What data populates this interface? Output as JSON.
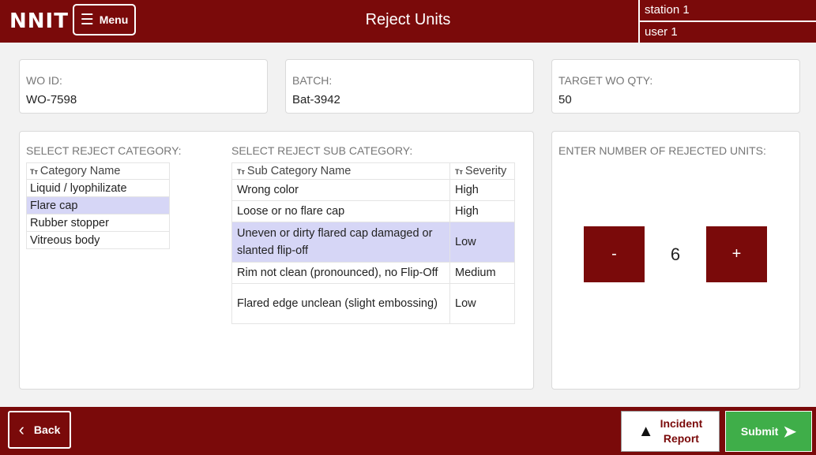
{
  "header": {
    "logo": "NNIT",
    "menu_label": "Menu",
    "title": "Reject Units",
    "station": "station 1",
    "user": "user 1"
  },
  "info": {
    "wo_id": {
      "label": "WO ID:",
      "value": "WO-7598"
    },
    "batch": {
      "label": "BATCH:",
      "value": "Bat-3942"
    },
    "target_qty": {
      "label": "TARGET WO QTY:",
      "value": "50"
    }
  },
  "category": {
    "label": "SELECT REJECT CATEGORY:",
    "column": "Category Name",
    "type_glyph": "Tт",
    "items": [
      "Liquid / lyophilizate",
      "Flare cap",
      "Rubber stopper",
      "Vitreous body"
    ],
    "selected_index": 1
  },
  "subcategory": {
    "label": "SELECT REJECT SUB CATEGORY:",
    "columns": [
      "Sub Category Name",
      "Severity"
    ],
    "rows": [
      {
        "name": "Wrong color",
        "severity": "High"
      },
      {
        "name": "Loose or no flare cap",
        "severity": "High"
      },
      {
        "name": "Uneven or dirty flared cap damaged or slanted flip-off",
        "severity": "Low"
      },
      {
        "name": "Rim not clean (pronounced), no Flip-Off",
        "severity": "Medium"
      },
      {
        "name": "Flared edge unclean (slight embossing)",
        "severity": "Low"
      }
    ],
    "selected_index": 2
  },
  "rejected": {
    "label": "ENTER NUMBER OF REJECTED UNITS:",
    "minus": "-",
    "value": "6",
    "plus": "+"
  },
  "footer": {
    "back": "Back",
    "incident_line1": "Incident",
    "incident_line2": "Report",
    "submit": "Submit"
  },
  "colors": {
    "brand": "#7a0a0a",
    "submit": "#3fae49",
    "selected_row": "#d6d6f6"
  }
}
